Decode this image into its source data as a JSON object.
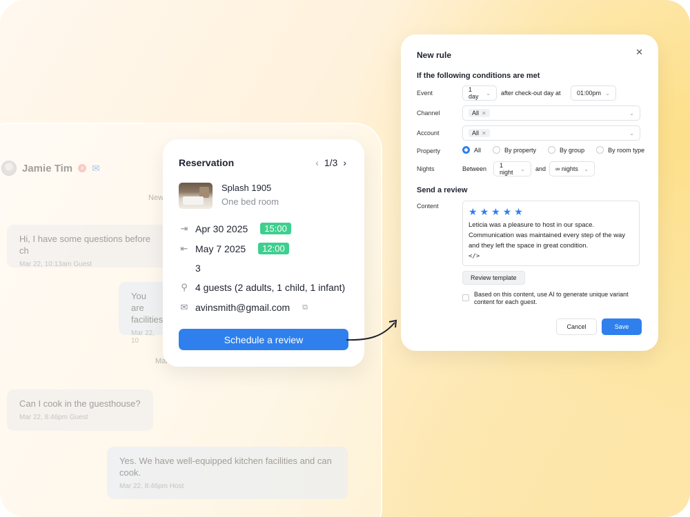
{
  "chat": {
    "guest_name": "Jamie Tim",
    "badge": "a",
    "messages": [
      {
        "text": "Hi, I have some questions before ch",
        "meta": "Mar 22, 10:13am   Guest",
        "role": "guest"
      },
      {
        "text": "You are",
        "text2": "facilities",
        "meta": "Mar 22, 10",
        "role": "host"
      },
      {
        "text": "Can I cook in the guesthouse?",
        "meta": "Mar 22, 8:46pm   Guest",
        "role": "guest"
      },
      {
        "text": "Yes. We have well-equipped kitchen facilities and can cook.",
        "meta": "Mar 22, 8:46pm   Host",
        "role": "host"
      }
    ],
    "day_labels": [
      "New",
      "Mar"
    ]
  },
  "reservation": {
    "title": "Reservation",
    "pager": "1/3",
    "property_name": "Splash 1905",
    "property_type": "One bed room",
    "checkin_date": "Apr 30 2025",
    "checkin_time": "15:00",
    "checkout_date": "May 7 2025",
    "checkout_time": "12:00",
    "nights": "3",
    "guests": "4 guests (2 adults, 1 child, 1 infant)",
    "email": "avinsmith@gmail.com",
    "schedule_button": "Schedule a review"
  },
  "rule": {
    "title": "New rule",
    "conditions_heading": "If the following conditions are met",
    "event_label": "Event",
    "event_offset": "1 day",
    "event_text": "after check-out day at",
    "event_time": "01:00pm",
    "channel_label": "Channel",
    "channel_value": "All",
    "account_label": "Account",
    "account_value": "All",
    "property_label": "Property",
    "property_options": [
      "All",
      "By property",
      "By group",
      "By room type"
    ],
    "property_selected": "All",
    "nights_label": "Nights",
    "nights_between": "Between",
    "nights_min": "1 night",
    "nights_and": "and",
    "nights_max": "∞ nights",
    "review_heading": "Send a review",
    "content_label": "Content",
    "rating_stars": 5,
    "review_line1": "Leticia was a pleasure to host in our space.",
    "review_line2": "Communication was maintained every step of the way and they left the space in great condition.",
    "code_icon": "</>",
    "template_button": "Review template",
    "ai_checkbox_text": "Based on this content, use AI to generate unique variant content for each guest.",
    "cancel_button": "Cancel",
    "save_button": "Save"
  },
  "colors": {
    "accent": "#2f80ed",
    "time_badge": "#3ecf8e"
  }
}
